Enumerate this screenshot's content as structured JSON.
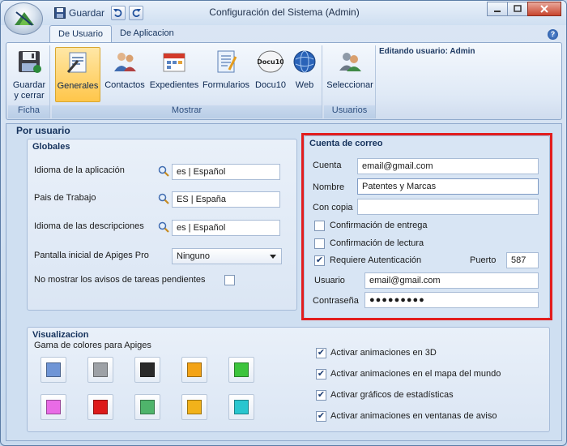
{
  "window": {
    "title": "Configuración del Sistema (Admin)",
    "qat_save_label": "Guardar"
  },
  "ribbon": {
    "tabs": [
      {
        "label": "De Usuario",
        "active": true
      },
      {
        "label": "De Aplicacion",
        "active": false
      }
    ],
    "groups": {
      "ficha": "Ficha",
      "mostrar": "Mostrar",
      "usuarios": "Usuarios"
    },
    "buttons": {
      "save_close_l1": "Guardar",
      "save_close_l2": "y cerrar",
      "generales": "Generales",
      "contactos": "Contactos",
      "expedientes": "Expedientes",
      "formularios": "Formularios",
      "docu10": "Docu10",
      "docu10_icon_text": "Docu10",
      "web": "Web",
      "seleccionar": "Seleccionar"
    },
    "edit_user": "Editando usuario: Admin"
  },
  "main": {
    "title": "Por usuario",
    "globales": {
      "title": "Globales",
      "app_language_label": "Idioma de la aplicación",
      "app_language_value": "es | Español",
      "country_label": "Pais de Trabajo",
      "country_value": "ES | España",
      "desc_language_label": "Idioma de las descripciones",
      "desc_language_value": "es | Español",
      "start_screen_label": "Pantalla inicial de Apiges Pro",
      "start_screen_value": "Ninguno",
      "hide_tasks_label": "No mostrar los avisos de tareas pendientes",
      "hide_tasks_checked": false
    },
    "correo": {
      "title": "Cuenta de correo",
      "cuenta_label": "Cuenta",
      "cuenta_value": "email@gmail.com",
      "nombre_label": "Nombre",
      "nombre_value": "Patentes y Marcas",
      "concopia_label": "Con copia",
      "concopia_value": "",
      "conf_entrega_label": "Confirmación de entrega",
      "conf_entrega_checked": false,
      "conf_lectura_label": "Confirmación de lectura",
      "conf_lectura_checked": false,
      "requiere_auth_label": "Requiere Autenticación",
      "requiere_auth_checked": true,
      "puerto_label": "Puerto",
      "puerto_value": "587",
      "usuario_label": "Usuario",
      "usuario_value": "email@gmail.com",
      "password_label": "Contraseña",
      "password_value": "●●●●●●●●●"
    },
    "visualizacion": {
      "title": "Visualizacion",
      "palette_label": "Gama de colores para Apiges",
      "swatches": [
        {
          "color": "#6f95d6"
        },
        {
          "color": "#9da1a6"
        },
        {
          "color": "#2a2a2a"
        },
        {
          "color": "#f3a316"
        },
        {
          "color": "#3cc43c"
        },
        {
          "color": "#e96be6"
        },
        {
          "color": "#dd1a1a"
        },
        {
          "color": "#4fb46b"
        },
        {
          "color": "#f2b21a"
        },
        {
          "color": "#29c6cf"
        }
      ],
      "options": [
        {
          "label": "Activar animaciones en 3D",
          "checked": true
        },
        {
          "label": "Activar animaciones en el mapa del mundo",
          "checked": true
        },
        {
          "label": "Activar gráficos de estadísticas",
          "checked": true
        },
        {
          "label": "Activar animaciones en ventanas de aviso",
          "checked": true
        }
      ]
    }
  }
}
